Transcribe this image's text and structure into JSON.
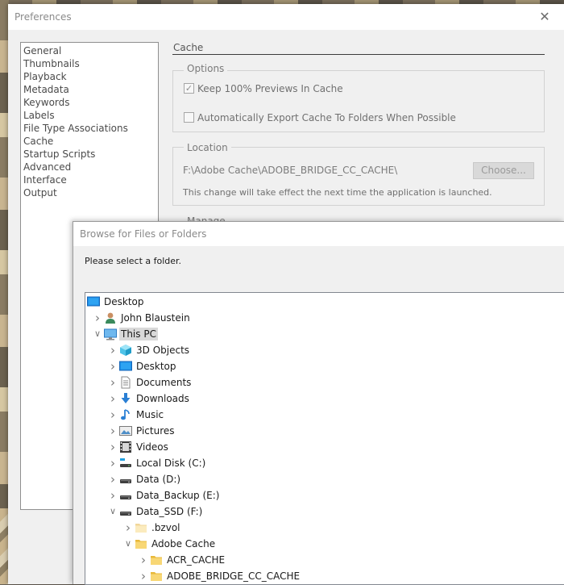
{
  "preferences": {
    "title": "Preferences",
    "categories": [
      "General",
      "Thumbnails",
      "Playback",
      "Metadata",
      "Keywords",
      "Labels",
      "File Type Associations",
      "Cache",
      "Startup Scripts",
      "Advanced",
      "Interface",
      "Output"
    ],
    "selected_category": "Cache",
    "section_title": "Cache",
    "options": {
      "label": "Options",
      "keep_previews": {
        "label": "Keep 100% Previews In Cache",
        "checked": true
      },
      "auto_export": {
        "label": "Automatically Export Cache To Folders When Possible",
        "checked": false
      }
    },
    "location": {
      "label": "Location",
      "path": "F:\\Adobe Cache\\ADOBE_BRIDGE_CC_CACHE\\",
      "choose_button": "Choose...",
      "note": "This change will take effect the next time the application is launched."
    },
    "manage_label": "Manage"
  },
  "browse_dialog": {
    "title": "Browse for Files or Folders",
    "instruction": "Please select a folder.",
    "tree": [
      {
        "label": "Desktop",
        "level": 0,
        "chevron": "",
        "icon": "desktop-icon"
      },
      {
        "label": "John Blaustein",
        "level": 1,
        "chevron": "collapsed",
        "icon": "user-icon"
      },
      {
        "label": "This PC",
        "level": 1,
        "chevron": "expanded",
        "icon": "computer-icon",
        "selected": true
      },
      {
        "label": "3D Objects",
        "level": 2,
        "chevron": "collapsed",
        "icon": "cube-icon"
      },
      {
        "label": "Desktop",
        "level": 2,
        "chevron": "collapsed",
        "icon": "desktop-icon"
      },
      {
        "label": "Documents",
        "level": 2,
        "chevron": "collapsed",
        "icon": "document-icon"
      },
      {
        "label": "Downloads",
        "level": 2,
        "chevron": "collapsed",
        "icon": "download-icon"
      },
      {
        "label": "Music",
        "level": 2,
        "chevron": "collapsed",
        "icon": "music-icon"
      },
      {
        "label": "Pictures",
        "level": 2,
        "chevron": "collapsed",
        "icon": "picture-icon"
      },
      {
        "label": "Videos",
        "level": 2,
        "chevron": "collapsed",
        "icon": "video-icon"
      },
      {
        "label": "Local Disk (C:)",
        "level": 2,
        "chevron": "collapsed",
        "icon": "system-drive-icon"
      },
      {
        "label": "Data (D:)",
        "level": 2,
        "chevron": "collapsed",
        "icon": "drive-icon"
      },
      {
        "label": "Data_Backup (E:)",
        "level": 2,
        "chevron": "collapsed",
        "icon": "drive-icon"
      },
      {
        "label": "Data_SSD (F:)",
        "level": 2,
        "chevron": "expanded",
        "icon": "drive-icon"
      },
      {
        "label": ".bzvol",
        "level": 3,
        "chevron": "collapsed",
        "icon": "folder-icon-empty"
      },
      {
        "label": "Adobe Cache",
        "level": 3,
        "chevron": "expanded",
        "icon": "folder-icon"
      },
      {
        "label": "ACR_CACHE",
        "level": 4,
        "chevron": "collapsed",
        "icon": "folder-icon"
      },
      {
        "label": "ADOBE_BRIDGE_CC_CACHE",
        "level": 4,
        "chevron": "collapsed",
        "icon": "folder-icon"
      }
    ]
  },
  "colors": {
    "window_bg": "#f0f0f0",
    "selection": "#d9d9d9",
    "folder_yellow": "#f8d775",
    "monitor_blue": "#1e90e8"
  }
}
